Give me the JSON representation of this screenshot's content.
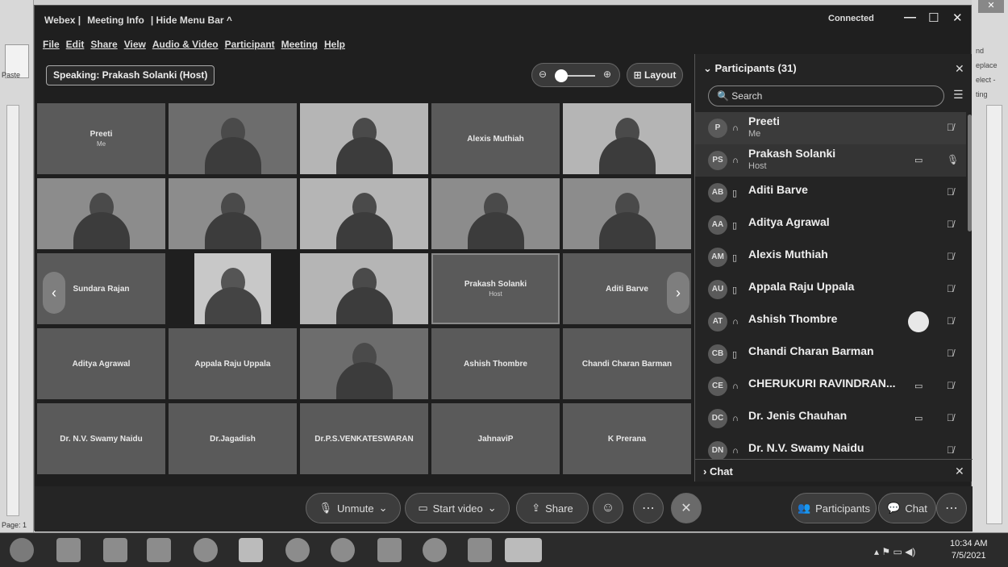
{
  "word": {
    "paste": "Paste",
    "page": "Page: 1",
    "right_items": [
      "nd",
      "eplace",
      "elect -",
      "ting"
    ]
  },
  "titlebar": {
    "app": "Webex |",
    "meeting_info": "Meeting Info",
    "hide_menu": "| Hide Menu Bar ^",
    "connected": "Connected",
    "min": "—",
    "max": "☐",
    "close": "✕"
  },
  "menu": [
    "File",
    "Edit",
    "Share",
    "View",
    "Audio & Video",
    "Participant",
    "Meeting",
    "Help"
  ],
  "speaking": "Speaking: Prakash Solanki (Host)",
  "layout": "Layout",
  "tiles": [
    {
      "name": "Preeti",
      "sub": "Me",
      "type": "name"
    },
    {
      "name": "",
      "sub": "",
      "type": "video"
    },
    {
      "name": "",
      "sub": "",
      "type": "video"
    },
    {
      "name": "Alexis Muthiah",
      "sub": "",
      "type": "name"
    },
    {
      "name": "",
      "sub": "",
      "type": "video"
    },
    {
      "name": "",
      "sub": "",
      "type": "video"
    },
    {
      "name": "",
      "sub": "",
      "type": "video"
    },
    {
      "name": "",
      "sub": "",
      "type": "video"
    },
    {
      "name": "",
      "sub": "",
      "type": "video"
    },
    {
      "name": "",
      "sub": "",
      "type": "video"
    },
    {
      "name": "Sundara Rajan",
      "sub": "",
      "type": "name"
    },
    {
      "name": "",
      "sub": "",
      "type": "inner"
    },
    {
      "name": "",
      "sub": "",
      "type": "video"
    },
    {
      "name": "Prakash Solanki",
      "sub": "Host",
      "type": "selected"
    },
    {
      "name": "Aditi Barve",
      "sub": "",
      "type": "name"
    },
    {
      "name": "Aditya Agrawal",
      "sub": "",
      "type": "name"
    },
    {
      "name": "Appala Raju Uppala",
      "sub": "",
      "type": "name"
    },
    {
      "name": "",
      "sub": "",
      "type": "video"
    },
    {
      "name": "Ashish Thombre",
      "sub": "",
      "type": "name"
    },
    {
      "name": "Chandi Charan Barman",
      "sub": "",
      "type": "name"
    },
    {
      "name": "Dr. N.V. Swamy Naidu",
      "sub": "",
      "type": "name"
    },
    {
      "name": "Dr.Jagadish",
      "sub": "",
      "type": "name"
    },
    {
      "name": "Dr.P.S.VENKATESWARAN",
      "sub": "",
      "type": "name"
    },
    {
      "name": "JahnaviP",
      "sub": "",
      "type": "name"
    },
    {
      "name": "K Prerana",
      "sub": "",
      "type": "name"
    }
  ],
  "controls": {
    "unmute": "Unmute",
    "start_video": "Start video",
    "share": "Share",
    "participants": "Participants",
    "chat": "Chat"
  },
  "panel": {
    "title": "Participants (31)",
    "search": "Search",
    "chat": "Chat"
  },
  "participants": [
    {
      "initials": "P",
      "name": "Preeti",
      "sub": "Me",
      "cam": false
    },
    {
      "initials": "PS",
      "name": "Prakash Solanki",
      "sub": "Host",
      "cam": true
    },
    {
      "initials": "AB",
      "name": "Aditi Barve",
      "sub": "",
      "cam": false
    },
    {
      "initials": "AA",
      "name": "Aditya Agrawal",
      "sub": "",
      "cam": false
    },
    {
      "initials": "AM",
      "name": "Alexis Muthiah",
      "sub": "",
      "cam": false
    },
    {
      "initials": "AU",
      "name": "Appala Raju Uppala",
      "sub": "",
      "cam": false
    },
    {
      "initials": "AT",
      "name": "Ashish Thombre",
      "sub": "",
      "cam": false
    },
    {
      "initials": "CB",
      "name": "Chandi Charan Barman",
      "sub": "",
      "cam": false
    },
    {
      "initials": "CE",
      "name": "CHERUKURI RAVINDRAN...",
      "sub": "",
      "cam": true
    },
    {
      "initials": "DC",
      "name": "Dr. Jenis Chauhan",
      "sub": "",
      "cam": true
    },
    {
      "initials": "DN",
      "name": "Dr. N.V. Swamy Naidu",
      "sub": "",
      "cam": false
    }
  ],
  "clock": {
    "time": "10:34 AM",
    "date": "7/5/2021"
  }
}
